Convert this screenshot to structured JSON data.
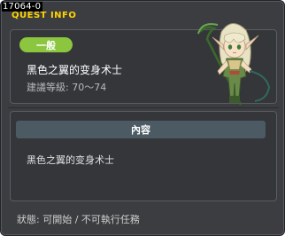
{
  "window": {
    "corner_tag": "17064-0",
    "title": "QUEST INFO"
  },
  "quest": {
    "badge": "一般",
    "name": "黑色之翼的变身术士",
    "level_label": "建議等級: 70～74"
  },
  "content": {
    "header": "內容",
    "text": "黑色之翼的变身术士"
  },
  "status": {
    "text": "狀態: 可開始 / 不可執行任務"
  },
  "colors": {
    "title": "#ffd400",
    "badge": "#8cc63e",
    "content_header": "#4b5a63"
  },
  "icons": {
    "npc": "elf-mage-npc-portrait"
  }
}
